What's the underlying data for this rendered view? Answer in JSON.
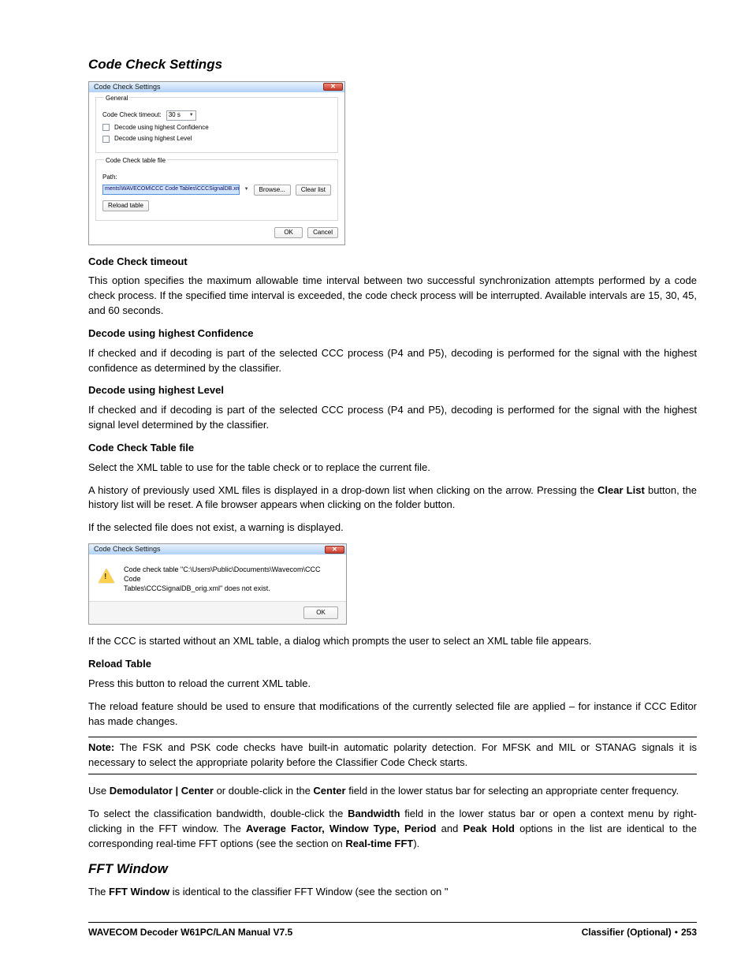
{
  "section1_title": "Code Check Settings",
  "section2_title": "FFT Window",
  "dlg1": {
    "title": "Code Check Settings",
    "grp_general": "General",
    "timeout_label": "Code Check timeout:",
    "timeout_value": "30 s",
    "conf_label": "Decode using highest Confidence",
    "level_label": "Decode using highest Level",
    "grp_file": "Code Check table file",
    "path_label": "Path:",
    "path_value": "ments\\WAVECOM\\CCC Code Tables\\CCCSignalDB.xml",
    "browse": "Browse...",
    "clearlist": "Clear list",
    "reload": "Reload table",
    "ok": "OK",
    "cancel": "Cancel"
  },
  "dlg2": {
    "title": "Code Check Settings",
    "msg1": "Code check table \"C:\\Users\\Public\\Documents\\Wavecom\\CCC Code",
    "msg2": "Tables\\CCCSignalDB_orig.xml\" does not exist.",
    "ok": "OK"
  },
  "h_cct": "Code Check timeout",
  "p_cct": "This option specifies the maximum allowable time interval between two successful synchronization attempts performed by a code check process. If the specified time interval is exceeded, the code check process will be interrupted. Available intervals are 15, 30, 45, and 60 seconds.",
  "h_conf": "Decode using highest Confidence",
  "p_conf": "If checked and if decoding is part of the selected CCC process (P4 and P5), decoding is performed for the signal with the highest confidence as determined by the classifier.",
  "h_lvl": "Decode using highest Level",
  "p_lvl": "If checked and if decoding is part of the selected CCC process (P4 and P5), decoding is performed for the signal with the highest signal level determined by the classifier.",
  "h_tbl": "Code Check Table file",
  "p_tbl1": "Select the XML table to use for the table check or to replace the current file.",
  "p_tbl2a": "A history of previously used XML files is displayed in a drop-down list when clicking on the arrow. Pressing the ",
  "p_tbl2b": "Clear List",
  "p_tbl2c": " button, the history list will be reset. A file browser appears when clicking on the folder button.",
  "p_tbl3": "If the selected file does not exist, a warning is displayed.",
  "p_after": "If the CCC is started without an XML table, a dialog which prompts the user to select an XML table file appears.",
  "h_rel": "Reload Table",
  "p_rel1": "Press this button to reload the current XML table.",
  "p_rel2": "The reload feature should be used to ensure that modifications of the currently selected file are applied – for instance if CCC Editor has made changes.",
  "note_b": "Note:",
  "note_t": " The FSK and PSK code checks have built-in automatic polarity detection. For MFSK and MIL or STANAG signals it is necessary to select the appropriate polarity before the Classifier Code Check starts.",
  "p_use1": "Use ",
  "p_use2": "Demodulator | Center",
  "p_use3": " or double-click in the ",
  "p_use4": "Center",
  "p_use5": " field in the lower status bar for selecting an appropriate center frequency.",
  "p_bw1": "To select the classification bandwidth, double-click the ",
  "p_bw2": "Bandwidth",
  "p_bw3": " field in the lower status bar or open a context menu by right-clicking in the FFT window. The ",
  "p_bw4": "Average Factor, Window Type, Period",
  "p_bw5": " and ",
  "p_bw6": "Peak Hold",
  "p_bw7": " options in the list are identical to the corresponding real-time FFT options (see the section on ",
  "p_bw8": "Real-time FFT",
  "p_bw9": ").",
  "p_fft1": "The ",
  "p_fft2": "FFT Window",
  "p_fft3": " is identical to the classifier FFT Window (see the section on \"",
  "footer_left": "WAVECOM Decoder W61PC/LAN Manual V7.5",
  "footer_right1": "Classifier (Optional)",
  "footer_right2": "253"
}
